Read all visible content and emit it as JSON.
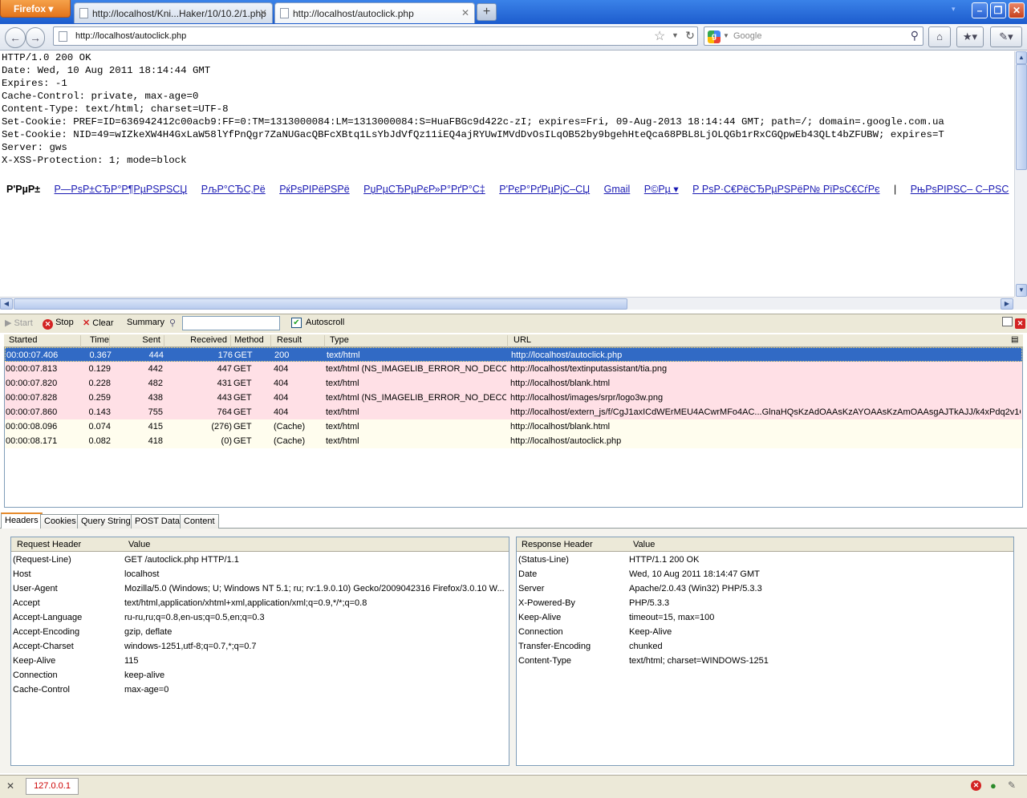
{
  "browser": {
    "menu_label": "Firefox",
    "tabs": [
      {
        "title": "http://localhost/Kni...Haker/10/10.2/1.php"
      },
      {
        "title": "http://localhost/autoclick.php"
      }
    ],
    "url": "http://localhost/autoclick.php",
    "search_placeholder": "Google"
  },
  "content": {
    "raw_response": "HTTP/1.0 200 OK\nDate: Wed, 10 Aug 2011 18:14:44 GMT\nExpires: -1\nCache-Control: private, max-age=0\nContent-Type: text/html; charset=UTF-8\nSet-Cookie: PREF=ID=636942412c00acb9:FF=0:TM=1313000084:LM=1313000084:S=HuaFBGc9d422c-zI; expires=Fri, 09-Aug-2013 18:14:44 GMT; path=/; domain=.google.com.ua\nSet-Cookie: NID=49=wIZkeXW4H4GxLaW58lYfPnQgr7ZaNUGacQBFcXBtq1LsYbJdVfQz11iEQ4ajRYUwIMVdDvOsILqOB52by9bgehHteQca68PBL8LjOLQGb1rRxCGQpwEb43QLt4bZFUBW; expires=T\nServer: gws\nX-XSS-Protection: 1; mode=block",
    "google_links": {
      "home": "Р'РµР±",
      "links": [
        "Р—РѕР±СЂР°Р¶РµРЅРЅСЏ",
        "РљР°СЂС‚Рё",
        "РќРѕРІРёРЅРё",
        "РџРµСЂРµРєР»Р°РґР°С‡",
        "Р'РєР°РґРµРјС–СЏ",
        "Gmail",
        "Р©Рµ ▾",
        "Р РѕР·С€РёСЂРµРЅРёР№ РїРѕС€СѓРє"
      ],
      "separator": "|",
      "last": "РњРѕРІРЅС– С–РЅС"
    }
  },
  "httpwatch": {
    "toolbar": {
      "start": "Start",
      "stop": "Stop",
      "clear": "Clear",
      "summary": "Summary",
      "autoscroll": "Autoscroll"
    },
    "columns": [
      "Started",
      "Time",
      "Sent",
      "Received",
      "Method",
      "Result",
      "Type",
      "URL"
    ],
    "requests": [
      {
        "started": "00:00:07.406",
        "time": "0.367",
        "sent": "444",
        "received": "176",
        "method": "GET",
        "result": "200",
        "type": "text/html",
        "url": "http://localhost/autoclick.php",
        "state": "sel"
      },
      {
        "started": "00:00:07.813",
        "time": "0.129",
        "sent": "442",
        "received": "447",
        "method": "GET",
        "result": "404",
        "type": "text/html (NS_IMAGELIB_ERROR_NO_DECO...",
        "url": "http://localhost/textinputassistant/tia.png",
        "state": "err"
      },
      {
        "started": "00:00:07.820",
        "time": "0.228",
        "sent": "482",
        "received": "431",
        "method": "GET",
        "result": "404",
        "type": "text/html",
        "url": "http://localhost/blank.html",
        "state": "err"
      },
      {
        "started": "00:00:07.828",
        "time": "0.259",
        "sent": "438",
        "received": "443",
        "method": "GET",
        "result": "404",
        "type": "text/html (NS_IMAGELIB_ERROR_NO_DECO...",
        "url": "http://localhost/images/srpr/logo3w.png",
        "state": "err"
      },
      {
        "started": "00:00:07.860",
        "time": "0.143",
        "sent": "755",
        "received": "764",
        "method": "GET",
        "result": "404",
        "type": "text/html",
        "url": "http://localhost/extern_js/f/CgJ1axICdWErMEU4ACwrMFo4AC...GlnaHQsKzAdOAAsKzAYOAAsKzAmOAAsgAJTkAJJ/k4xPdq2v1Gs.js",
        "state": "err"
      },
      {
        "started": "00:00:08.096",
        "time": "0.074",
        "sent": "415",
        "received": "(276)",
        "method": "GET",
        "result": "(Cache)",
        "type": "text/html",
        "url": "http://localhost/blank.html",
        "state": "cache"
      },
      {
        "started": "00:00:08.171",
        "time": "0.082",
        "sent": "418",
        "received": "(0)",
        "method": "GET",
        "result": "(Cache)",
        "type": "text/html",
        "url": "http://localhost/autoclick.php",
        "state": "cache"
      }
    ],
    "detail_tabs": [
      "Headers",
      "Cookies",
      "Query String",
      "POST Data",
      "Content"
    ],
    "request_headers": {
      "col1": "Request Header",
      "col2": "Value",
      "rows": [
        [
          "(Request-Line)",
          "GET /autoclick.php HTTP/1.1"
        ],
        [
          "Host",
          "localhost"
        ],
        [
          "User-Agent",
          "Mozilla/5.0 (Windows; U; Windows NT 5.1; ru; rv:1.9.0.10) Gecko/2009042316 Firefox/3.0.10 W..."
        ],
        [
          "Accept",
          "text/html,application/xhtml+xml,application/xml;q=0.9,*/*;q=0.8"
        ],
        [
          "Accept-Language",
          "ru-ru,ru;q=0.8,en-us;q=0.5,en;q=0.3"
        ],
        [
          "Accept-Encoding",
          "gzip, deflate"
        ],
        [
          "Accept-Charset",
          "windows-1251,utf-8;q=0.7,*;q=0.7"
        ],
        [
          "Keep-Alive",
          "115"
        ],
        [
          "Connection",
          "keep-alive"
        ],
        [
          "Cache-Control",
          "max-age=0"
        ]
      ]
    },
    "response_headers": {
      "col1": "Response Header",
      "col2": "Value",
      "rows": [
        [
          "(Status-Line)",
          "HTTP/1.1 200 OK"
        ],
        [
          "Date",
          "Wed, 10 Aug 2011 18:14:47 GMT"
        ],
        [
          "Server",
          "Apache/2.0.43 (Win32) PHP/5.3.3"
        ],
        [
          "X-Powered-By",
          "PHP/5.3.3"
        ],
        [
          "Keep-Alive",
          "timeout=15, max=100"
        ],
        [
          "Connection",
          "Keep-Alive"
        ],
        [
          "Transfer-Encoding",
          "chunked"
        ],
        [
          "Content-Type",
          "text/html; charset=WINDOWS-1251"
        ]
      ]
    }
  },
  "statusbar": {
    "ip": "127.0.0.1"
  }
}
